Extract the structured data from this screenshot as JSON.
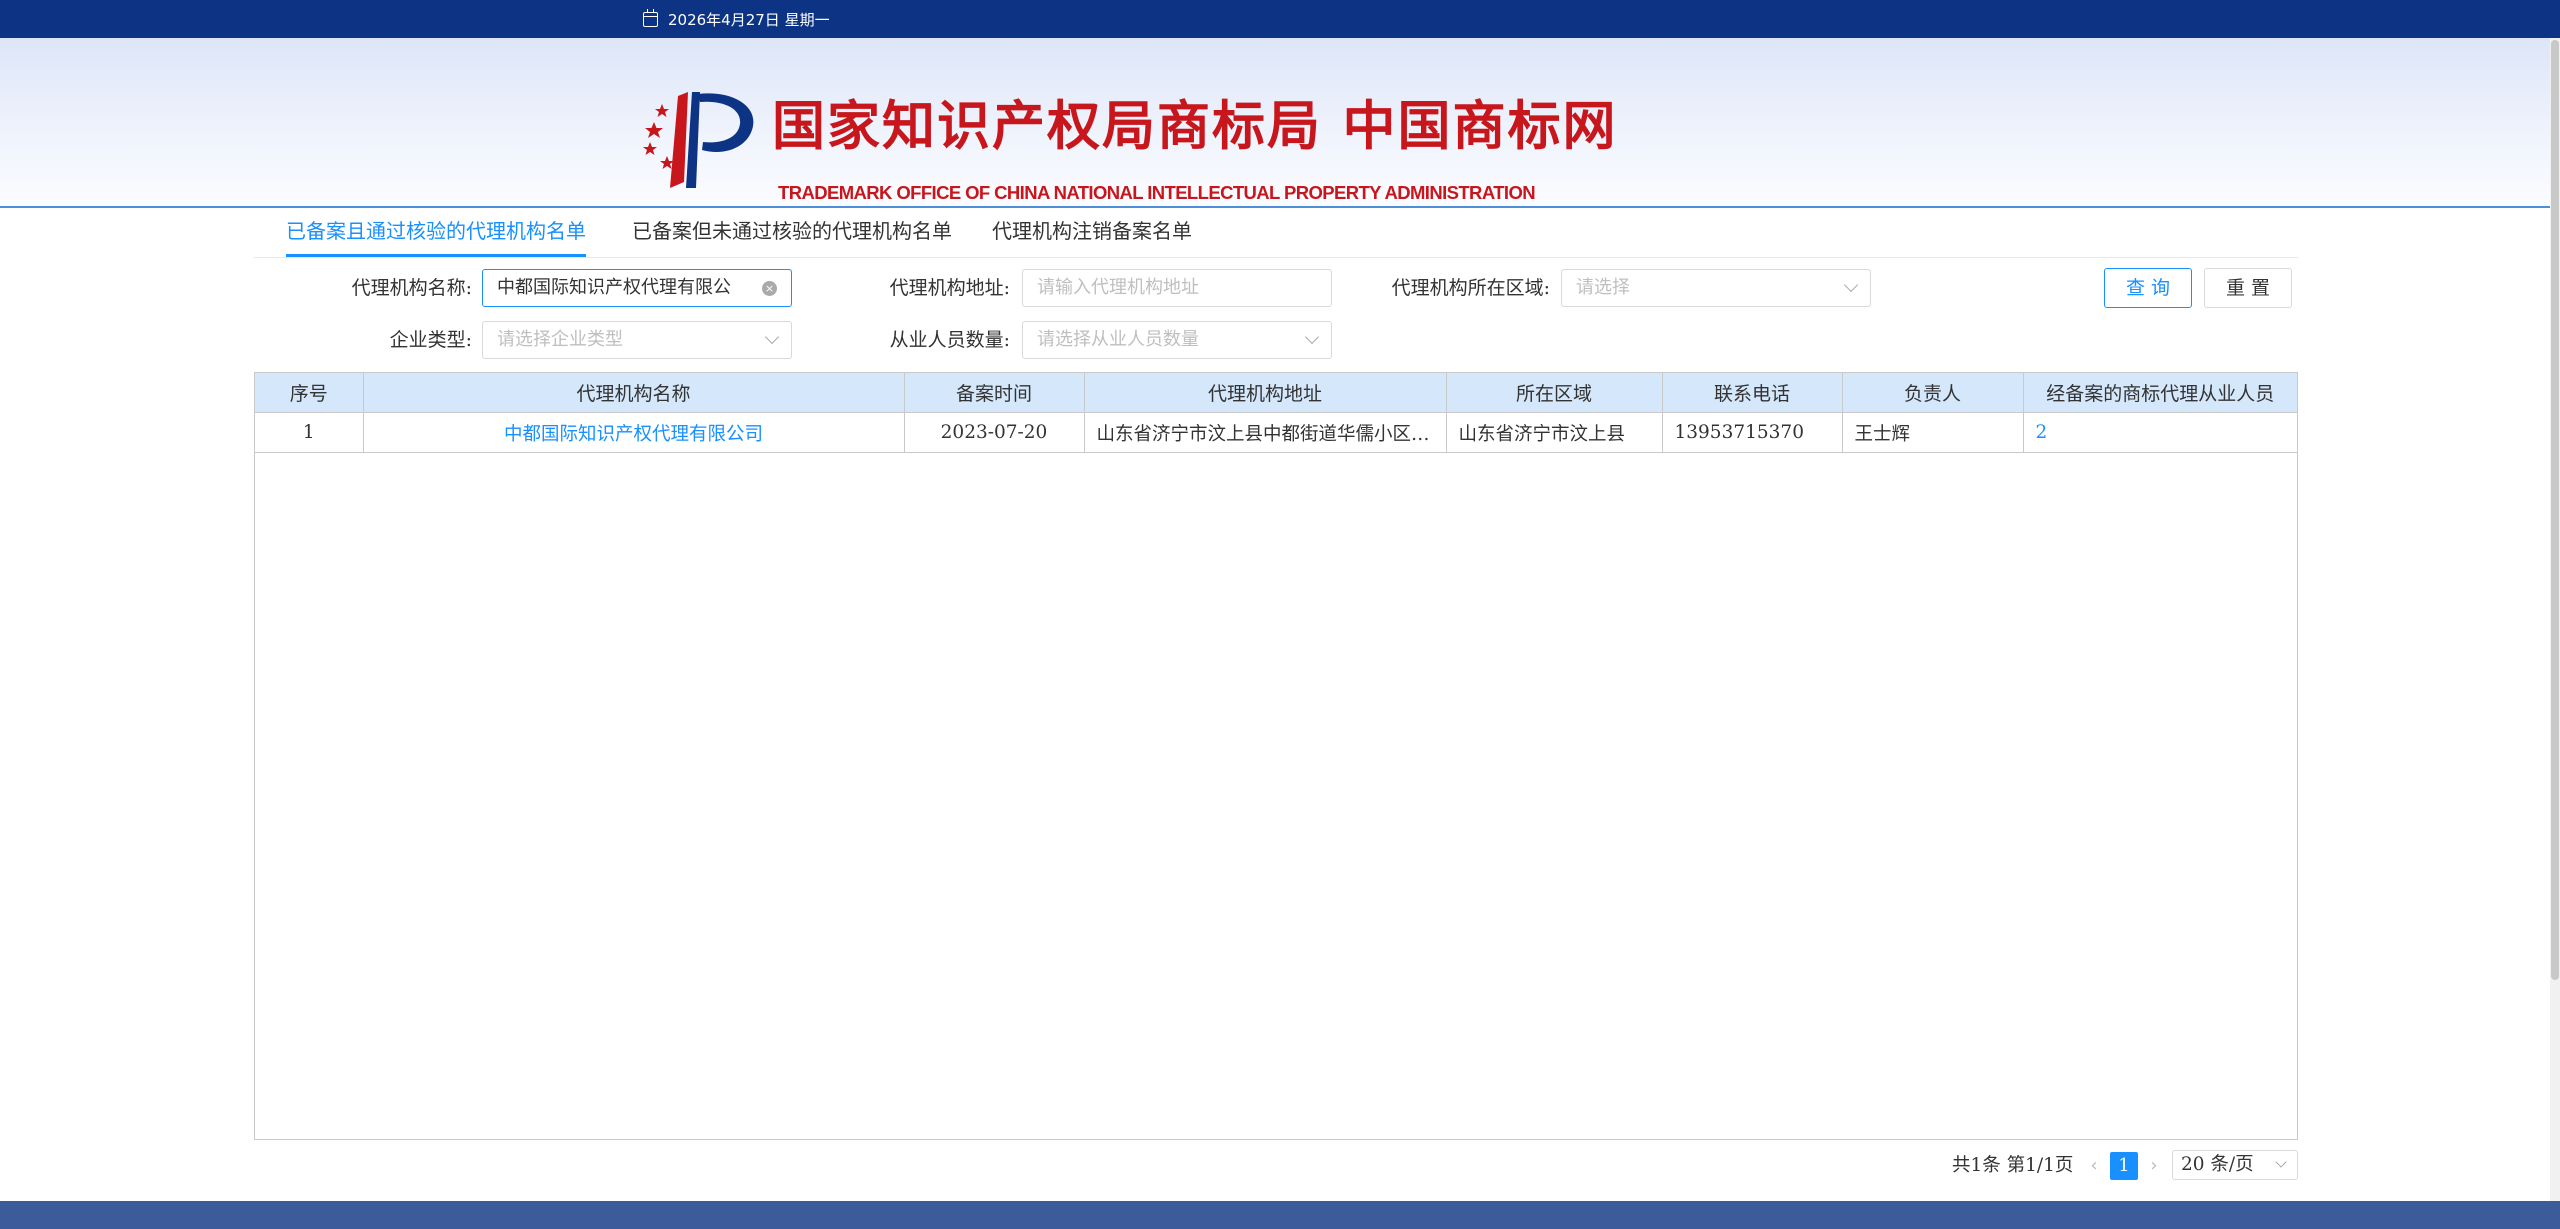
{
  "topbar": {
    "date": "2026年4月27日  星期一"
  },
  "header": {
    "title": "国家知识产权局商标局 中国商标网",
    "subtitle": "TRADEMARK OFFICE OF CHINA NATIONAL INTELLECTUAL PROPERTY ADMINISTRATION",
    "brand_red": "#c8161d",
    "brand_blue": "#0c3384"
  },
  "tabs": [
    {
      "label": "已备案且通过核验的代理机构名单",
      "active": true
    },
    {
      "label": "已备案但未通过核验的代理机构名单",
      "active": false
    },
    {
      "label": "代理机构注销备案名单",
      "active": false
    }
  ],
  "form": {
    "name_label": "代理机构名称:",
    "name_value": "中都国际知识产权代理有限公",
    "address_label": "代理机构地址:",
    "address_placeholder": "请输入代理机构地址",
    "region_label": "代理机构所在区域:",
    "region_placeholder": "请选择",
    "type_label": "企业类型:",
    "type_placeholder": "请选择企业类型",
    "staff_label": "从业人员数量:",
    "staff_placeholder": "请选择从业人员数量",
    "query_button": "查询",
    "reset_button": "重置"
  },
  "table": {
    "headers": [
      "序号",
      "代理机构名称",
      "备案时间",
      "代理机构地址",
      "所在区域",
      "联系电话",
      "负责人",
      "经备案的商标代理从业人员"
    ],
    "rows": [
      [
        "1",
        "中都国际知识产权代理有限公司",
        "2023-07-20",
        "山东省济宁市汶上县中都街道华儒小区门面",
        "山东省济宁市汶上县",
        "13953715370",
        "王士辉",
        "2"
      ]
    ]
  },
  "pagination": {
    "summary": "共1条  第1/1页",
    "prev": "‹",
    "current_page": "1",
    "next": "›",
    "page_size": "20 条/页"
  },
  "accent_color": "#1890ff"
}
